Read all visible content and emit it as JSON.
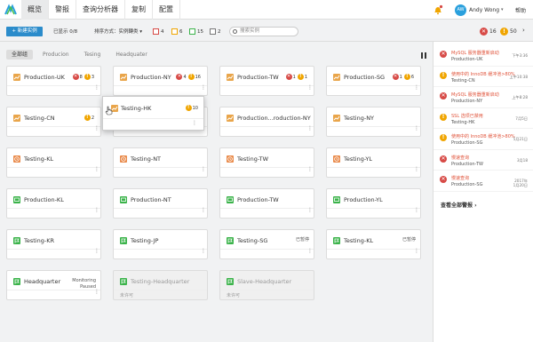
{
  "nav": {
    "tabs": [
      "概览",
      "警报",
      "查询分析器",
      "复制",
      "配置"
    ],
    "active": 0,
    "user": {
      "initials": "AW",
      "name": "Andy Wong"
    },
    "help": "帮助"
  },
  "toolbar": {
    "new_instance": "+ 新建实例",
    "shown": "已显示 0/8",
    "sort": "排序方式：实例轉类",
    "filters": [
      {
        "count": "4",
        "color": "#d74a46"
      },
      {
        "count": "6",
        "color": "#f0a500"
      },
      {
        "count": "15",
        "color": "#3bb34a"
      },
      {
        "count": "2",
        "color": "#777777"
      }
    ],
    "search_placeholder": "搜索实例",
    "summary_red": "16",
    "summary_yellow": "50"
  },
  "groups": [
    "全部组",
    "Producion",
    "Tesing",
    "Headquater"
  ],
  "cards": [
    {
      "name": "Production-UK",
      "icon": "chart-icon",
      "red": "8",
      "yellow": "3"
    },
    {
      "name": "Production-NY",
      "icon": "chart-icon",
      "red": "4",
      "yellow": "16"
    },
    {
      "name": "Production-TW",
      "icon": "chart-icon",
      "red": "1",
      "yellow": "1"
    },
    {
      "name": "Production-SG",
      "icon": "chart-icon",
      "red": "1",
      "yellow": "6"
    },
    {
      "name": "Testing-CN",
      "icon": "chart-icon",
      "yellow": "2"
    },
    {
      "name": "Testing-HK",
      "icon": "chart-icon"
    },
    {
      "name": "Production...roduction-NY",
      "icon": "chart-icon"
    },
    {
      "name": "Testing-NY",
      "icon": "chart-icon"
    },
    {
      "name": "Testing-KL",
      "icon": "clock-icon"
    },
    {
      "name": "Testing-NT",
      "icon": "clock-icon"
    },
    {
      "name": "Testing-TW",
      "icon": "clock-icon"
    },
    {
      "name": "Testing-YL",
      "icon": "clock-icon"
    },
    {
      "name": "Production-KL",
      "icon": "monitor-icon"
    },
    {
      "name": "Production-NT",
      "icon": "monitor-icon"
    },
    {
      "name": "Production-TW",
      "icon": "monitor-icon"
    },
    {
      "name": "Production-YL",
      "icon": "monitor-icon"
    },
    {
      "name": "Testing-KR",
      "icon": "flag-icon"
    },
    {
      "name": "Testing-JP",
      "icon": "flag-icon"
    },
    {
      "name": "Testing-SG",
      "icon": "flag-icon",
      "note": "已暂停"
    },
    {
      "name": "Testing-KL",
      "icon": "flag-icon",
      "note": "已暂停"
    },
    {
      "name": "Headquarter",
      "icon": "flag-icon",
      "note": "Monitoring\nPaused"
    },
    {
      "name": "Testing-Headquarter",
      "icon": "flag-icon",
      "dim": true,
      "foot": "未许可"
    },
    {
      "name": "Slave-Headquarter",
      "icon": "flag-icon",
      "dim": true,
      "foot": "未许可"
    }
  ],
  "popup": {
    "name": "Testing-HK",
    "yellow": "10"
  },
  "alerts": [
    {
      "type": "red",
      "title": "MySQL 服务器重新启动",
      "source": "Production-UK",
      "time": "下午3:36"
    },
    {
      "type": "yel",
      "title": "使用中的 InnoDB 缓冲池>80%",
      "source": "Testing-CN",
      "time": "上午10:38"
    },
    {
      "type": "red",
      "title": "MySQL 服务器重新启动",
      "source": "Production-NY",
      "time": "上午8:28"
    },
    {
      "type": "yel",
      "title": "SSL 选项已禁用",
      "source": "Testing-HK",
      "time": "7月5日"
    },
    {
      "type": "yel",
      "title": "使用中的 InnoDB 缓冲池>80%",
      "source": "Production-SG",
      "time": "5月21日"
    },
    {
      "type": "red",
      "title": "慢速查询",
      "source": "Production-TW",
      "time": "3月18"
    },
    {
      "type": "red",
      "title": "慢速查询",
      "source": "Production-SG",
      "time": "2017年\n1月20日"
    }
  ],
  "view_all": "查看全部警报"
}
